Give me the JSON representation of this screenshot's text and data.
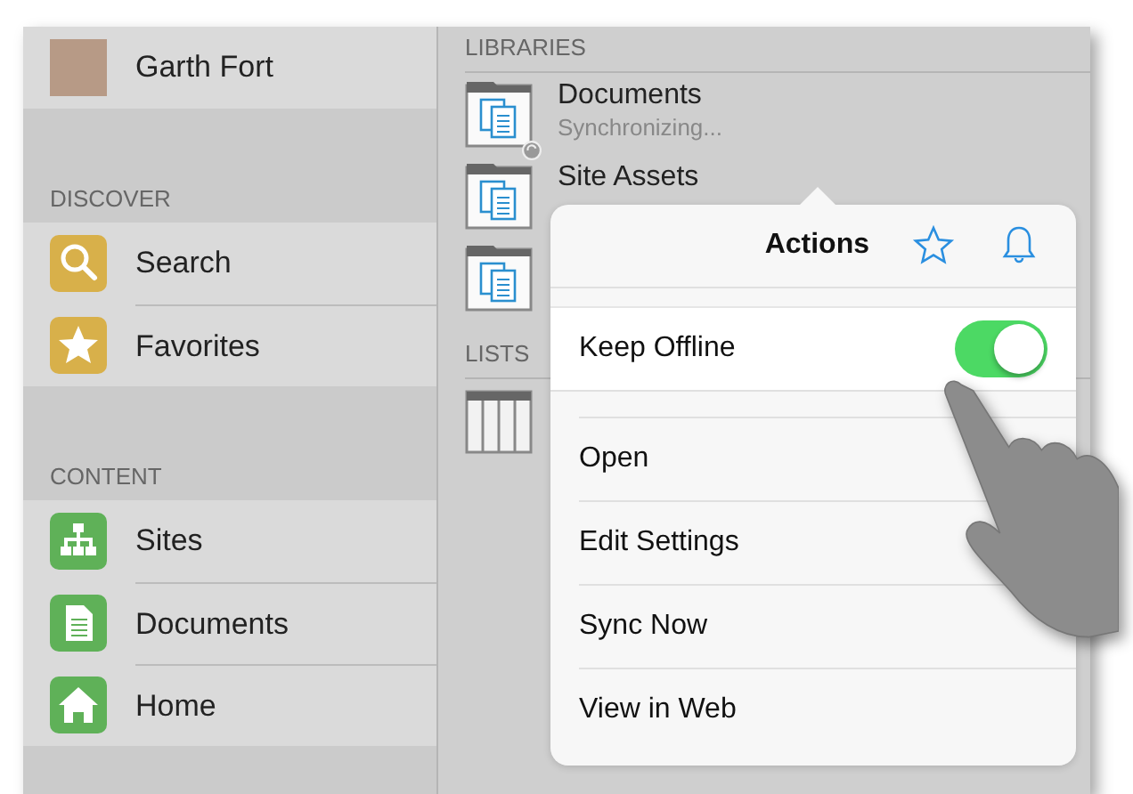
{
  "profile": {
    "name": "Garth Fort"
  },
  "sidebar": {
    "sections": [
      {
        "heading": "DISCOVER",
        "items": [
          {
            "label": "Search",
            "kind": "search",
            "color": "#d8b04a"
          },
          {
            "label": "Favorites",
            "kind": "star",
            "color": "#d8b04a"
          }
        ]
      },
      {
        "heading": "CONTENT",
        "items": [
          {
            "label": "Sites",
            "kind": "sites",
            "color": "#5fb158"
          },
          {
            "label": "Documents",
            "kind": "document",
            "color": "#5fb158"
          },
          {
            "label": "Home",
            "kind": "home",
            "color": "#5fb158"
          }
        ]
      }
    ]
  },
  "libraries": {
    "heading": "LIBRARIES",
    "items": [
      {
        "kind": "library",
        "title": "Documents",
        "subtitle": "Synchronizing...",
        "syncing": true
      },
      {
        "kind": "library",
        "title": "Site Assets",
        "syncing": false
      },
      {
        "kind": "library",
        "syncing": false
      }
    ]
  },
  "lists": {
    "heading": "LISTS",
    "items": [
      {
        "kind": "table"
      }
    ]
  },
  "popover": {
    "title": "Actions",
    "toggles": [
      {
        "label": "Keep Offline",
        "on": true
      }
    ],
    "actions": [
      "Open",
      "Edit Settings",
      "Sync Now",
      "View in Web"
    ]
  }
}
